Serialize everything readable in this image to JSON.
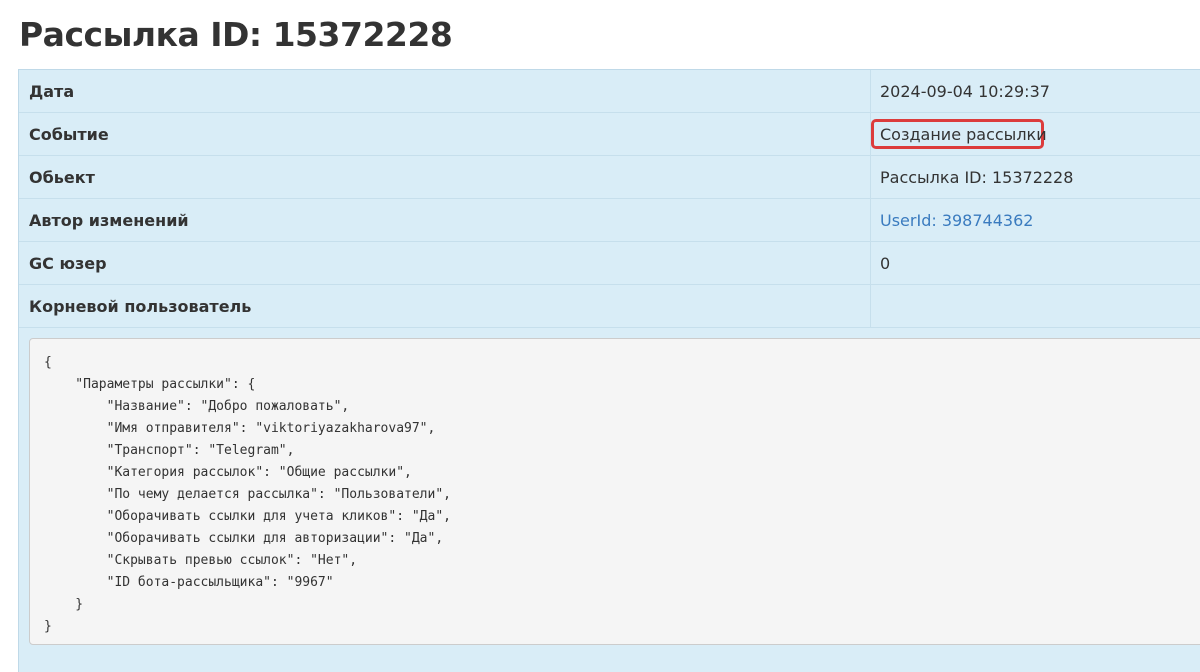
{
  "title": "Рассылка ID: 15372228",
  "rows": [
    {
      "label": "Дата",
      "value": "2024-09-04 10:29:37",
      "is_link": false
    },
    {
      "label": "Событие",
      "value": "Создание рассылки",
      "is_link": false,
      "highlighted": true
    },
    {
      "label": "Обьект",
      "value": "Рассылка ID: 15372228",
      "is_link": false
    },
    {
      "label": "Автор изменений",
      "value": "UserId: 398744362",
      "is_link": true
    },
    {
      "label": "GC юзер",
      "value": "0",
      "is_link": false
    },
    {
      "label": "Корневой пользователь",
      "value": "",
      "is_link": false
    }
  ],
  "code_lines": [
    "{",
    "    \"Параметры рассылки\": {",
    "        \"Название\": \"Добро пожаловать\",",
    "        \"Имя отправителя\": \"viktoriyazakharova97\",",
    "        \"Транспорт\": \"Telegram\",",
    "        \"Категория рассылок\": \"Общие рассылки\",",
    "        \"По чему делается рассылка\": \"Пользователи\",",
    "        \"Оборачивать ссылки для учета кликов\": \"Да\",",
    "        \"Оборачивать ссылки для авторизации\": \"Да\",",
    "        \"Скрывать превью ссылок\": \"Нет\",",
    "        \"ID бота-рассыльщика\": \"9967\"",
    "    }",
    "}"
  ],
  "colors": {
    "panel_bg": "#d9edf7",
    "link": "#3a7bbf",
    "highlight_border": "#dc3c3c",
    "code_bg": "#f5f5f5"
  }
}
